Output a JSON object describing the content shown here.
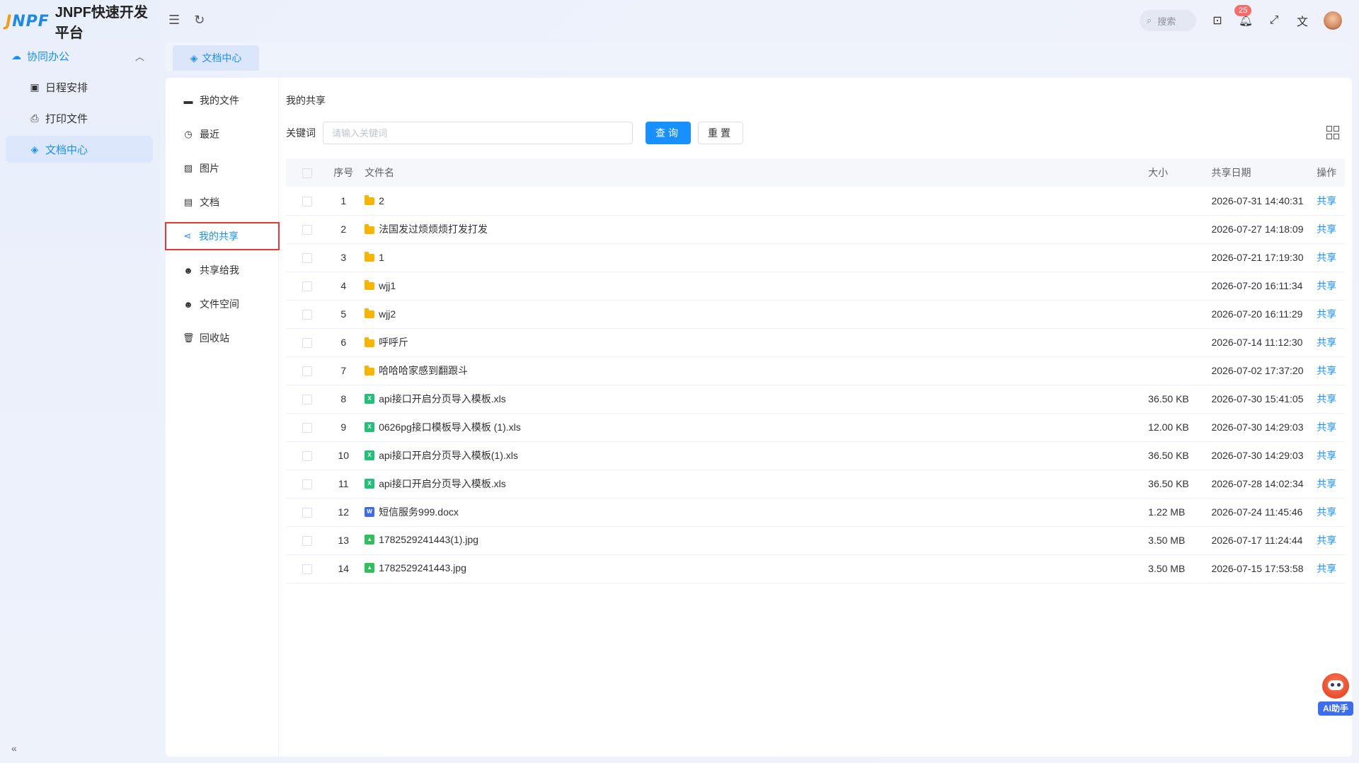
{
  "app": {
    "logo_mark_j": "J",
    "logo_mark_rest": "NPF",
    "title": "JNPF快速开发平台"
  },
  "sidebar": {
    "group": {
      "label": "协同办公",
      "icon": "cloud-icon"
    },
    "items": [
      {
        "label": "日程安排",
        "icon": "calendar-icon",
        "active": false
      },
      {
        "label": "打印文件",
        "icon": "printer-icon",
        "active": false
      },
      {
        "label": "文档中心",
        "icon": "layers-icon",
        "active": true
      }
    ]
  },
  "topbar": {
    "search_placeholder": "搜索",
    "notification_count": "25"
  },
  "tabs": [
    {
      "label": "文档中心",
      "icon": "layers-icon"
    }
  ],
  "file_menu": [
    {
      "label": "我的文件",
      "icon": "folder-icon"
    },
    {
      "label": "最近",
      "icon": "clock-icon"
    },
    {
      "label": "图片",
      "icon": "image-icon"
    },
    {
      "label": "文档",
      "icon": "document-icon"
    },
    {
      "label": "我的共享",
      "icon": "share-icon",
      "active": true
    },
    {
      "label": "共享给我",
      "icon": "user-share-icon"
    },
    {
      "label": "文件空间",
      "icon": "user-space-icon"
    },
    {
      "label": "回收站",
      "icon": "trash-icon"
    }
  ],
  "main": {
    "section_title": "我的共享",
    "filter": {
      "keyword_label": "关键词",
      "keyword_placeholder": "请输入关键词",
      "query_button": "查询",
      "reset_button": "重置"
    },
    "table": {
      "headers": {
        "index": "序号",
        "name": "文件名",
        "size": "大小",
        "date": "共享日期",
        "op": "操作"
      },
      "rows": [
        {
          "index": "1",
          "name": "2",
          "type": "folder",
          "size": "",
          "date": "2026-07-31 14:40:31",
          "op": "共享"
        },
        {
          "index": "2",
          "name": "法国发过烦烦烦打发打发",
          "type": "folder",
          "size": "",
          "date": "2026-07-27 14:18:09",
          "op": "共享"
        },
        {
          "index": "3",
          "name": "1",
          "type": "folder",
          "size": "",
          "date": "2026-07-21 17:19:30",
          "op": "共享"
        },
        {
          "index": "4",
          "name": "wjj1",
          "type": "folder",
          "size": "",
          "date": "2026-07-20 16:11:34",
          "op": "共享"
        },
        {
          "index": "5",
          "name": "wjj2",
          "type": "folder",
          "size": "",
          "date": "2026-07-20 16:11:29",
          "op": "共享"
        },
        {
          "index": "6",
          "name": "呼呼斤",
          "type": "folder",
          "size": "",
          "date": "2026-07-14 11:12:30",
          "op": "共享"
        },
        {
          "index": "7",
          "name": "哈哈哈家感到翻跟斗",
          "type": "folder",
          "size": "",
          "date": "2026-07-02 17:37:20",
          "op": "共享"
        },
        {
          "index": "8",
          "name": "api接口开启分页导入模板.xls",
          "type": "xls",
          "size": "36.50 KB",
          "date": "2026-07-30 15:41:05",
          "op": "共享"
        },
        {
          "index": "9",
          "name": "0626pg接口模板导入模板 (1).xls",
          "type": "xls",
          "size": "12.00 KB",
          "date": "2026-07-30 14:29:03",
          "op": "共享"
        },
        {
          "index": "10",
          "name": "api接口开启分页导入模板(1).xls",
          "type": "xls",
          "size": "36.50 KB",
          "date": "2026-07-30 14:29:03",
          "op": "共享"
        },
        {
          "index": "11",
          "name": "api接口开启分页导入模板.xls",
          "type": "xls",
          "size": "36.50 KB",
          "date": "2026-07-28 14:02:34",
          "op": "共享"
        },
        {
          "index": "12",
          "name": "短信服务999.docx",
          "type": "doc",
          "size": "1.22 MB",
          "date": "2026-07-24 11:45:46",
          "op": "共享"
        },
        {
          "index": "13",
          "name": "1782529241443(1).jpg",
          "type": "img",
          "size": "3.50 MB",
          "date": "2026-07-17 11:24:44",
          "op": "共享"
        },
        {
          "index": "14",
          "name": "1782529241443.jpg",
          "type": "img",
          "size": "3.50 MB",
          "date": "2026-07-15 17:53:58",
          "op": "共享"
        }
      ]
    }
  },
  "ai_helper": {
    "label": "AI助手"
  },
  "colors": {
    "primary": "#1890ff",
    "badge": "#f56c6c",
    "folder": "#f7b500",
    "xls": "#21c17a",
    "doc": "#3f6af0",
    "img": "#2fbf5b",
    "highlight_border": "#e53935"
  }
}
